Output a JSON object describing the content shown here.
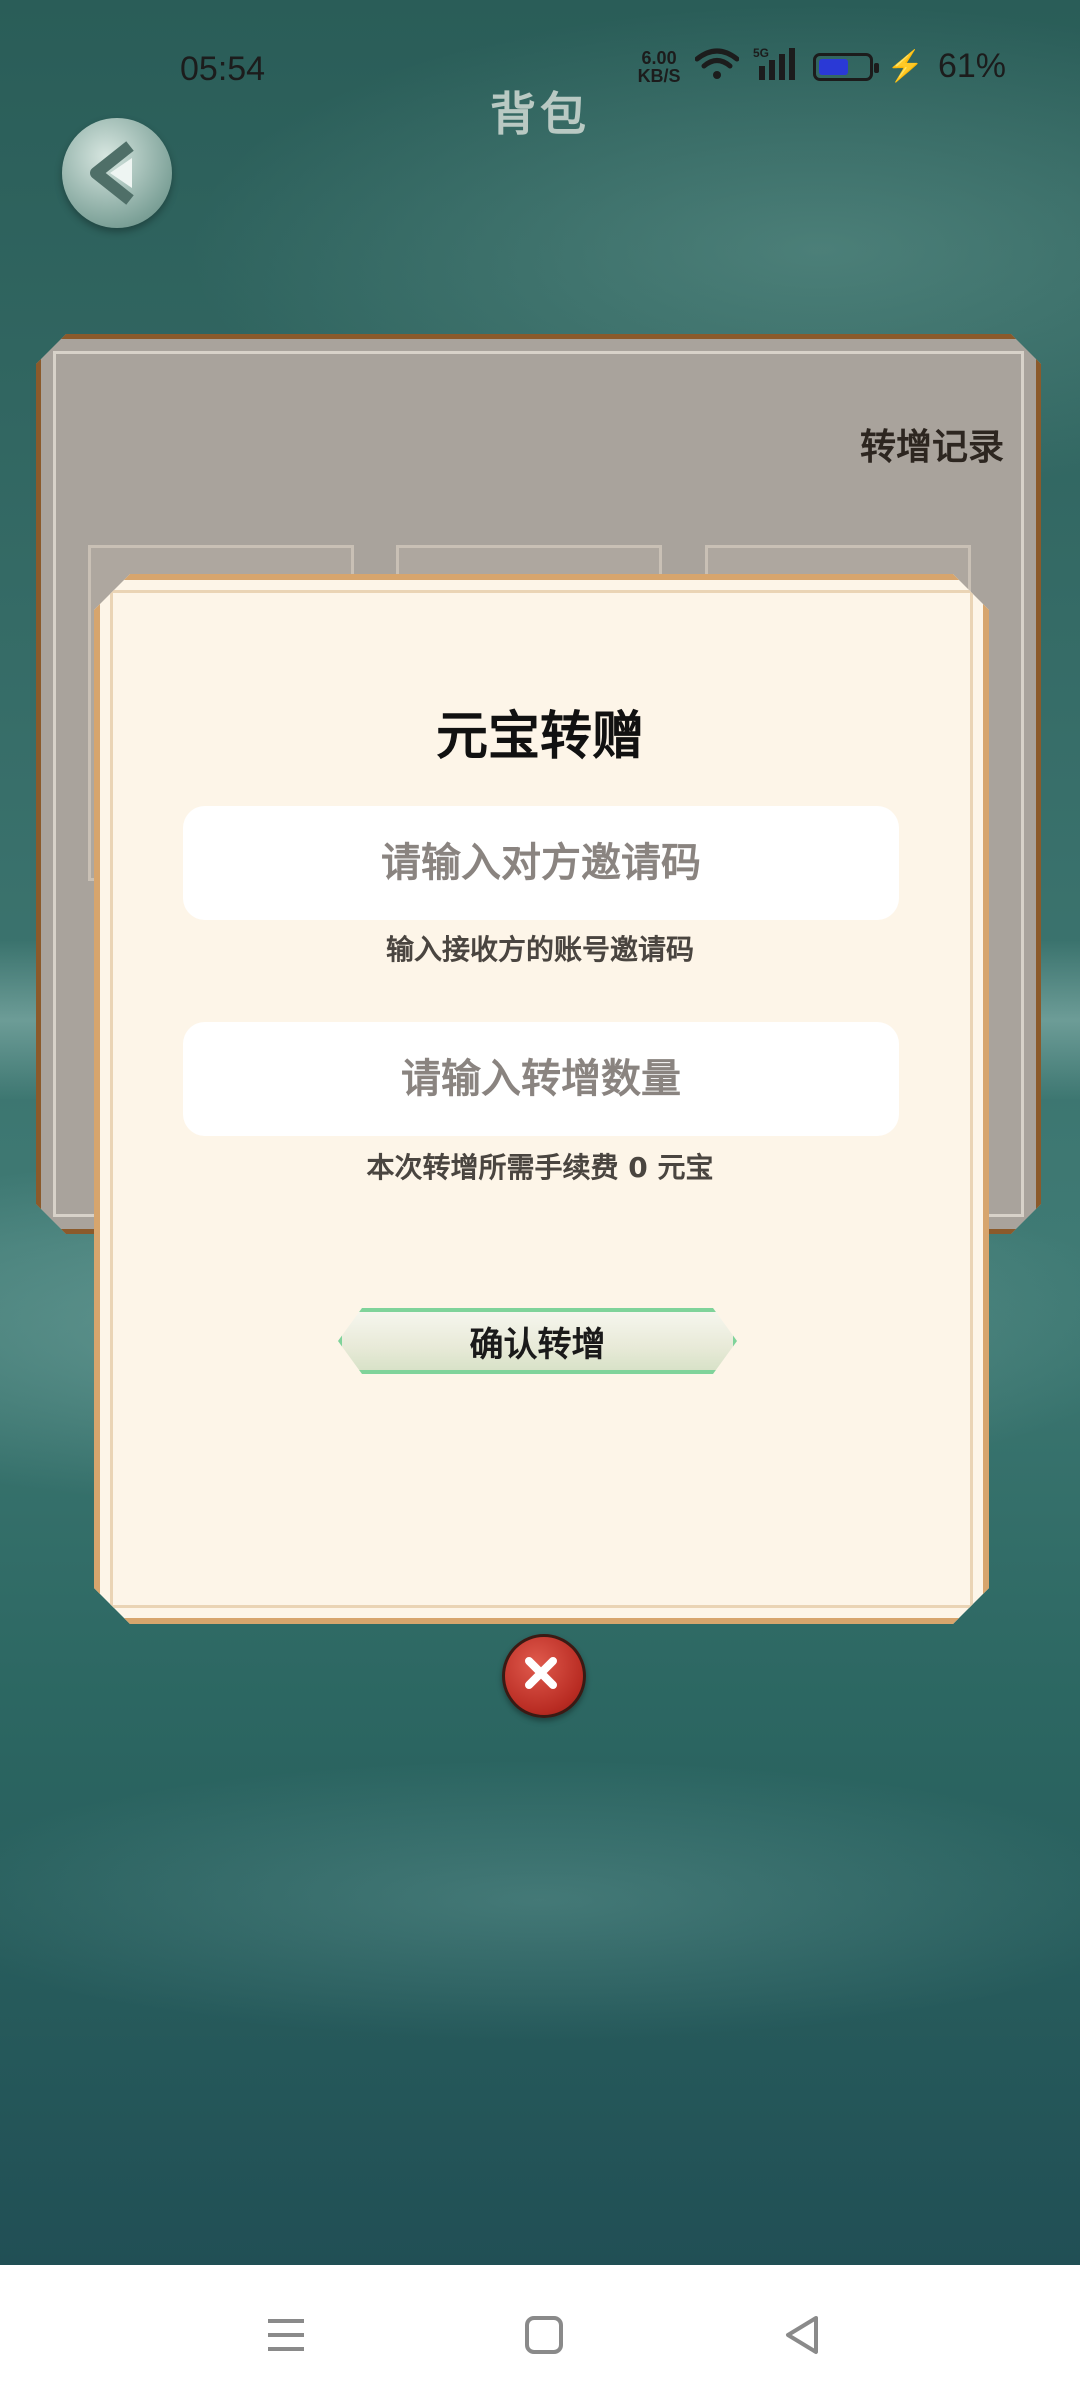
{
  "status_bar": {
    "time": "05:54",
    "net_speed_value": "6.00",
    "net_speed_unit": "KB/S",
    "network_type": "5G",
    "battery_percent": "61%",
    "battery_level": 0.61
  },
  "header": {
    "title": "背包"
  },
  "panel": {
    "records_link": "转增记录"
  },
  "modal": {
    "title": "元宝转赠",
    "invite_code": {
      "placeholder": "请输入对方邀请码",
      "value": "",
      "hint": "输入接收方的账号邀请码"
    },
    "amount": {
      "placeholder": "请输入转增数量",
      "value": "",
      "hint": "本次转增所需手续费 0 元宝"
    },
    "confirm_label": "确认转增"
  },
  "icons": {
    "back": "back-arrow-icon",
    "close": "close-icon",
    "nav_menu": "menu-icon",
    "nav_home": "home-icon",
    "nav_back": "triangle-back-icon"
  },
  "colors": {
    "modal_bg": "#fdf5e8",
    "modal_border": "#d7a56d",
    "confirm_border": "#7fd39a",
    "close_red": "#c9362b",
    "battery_fill": "#2a39d6"
  }
}
